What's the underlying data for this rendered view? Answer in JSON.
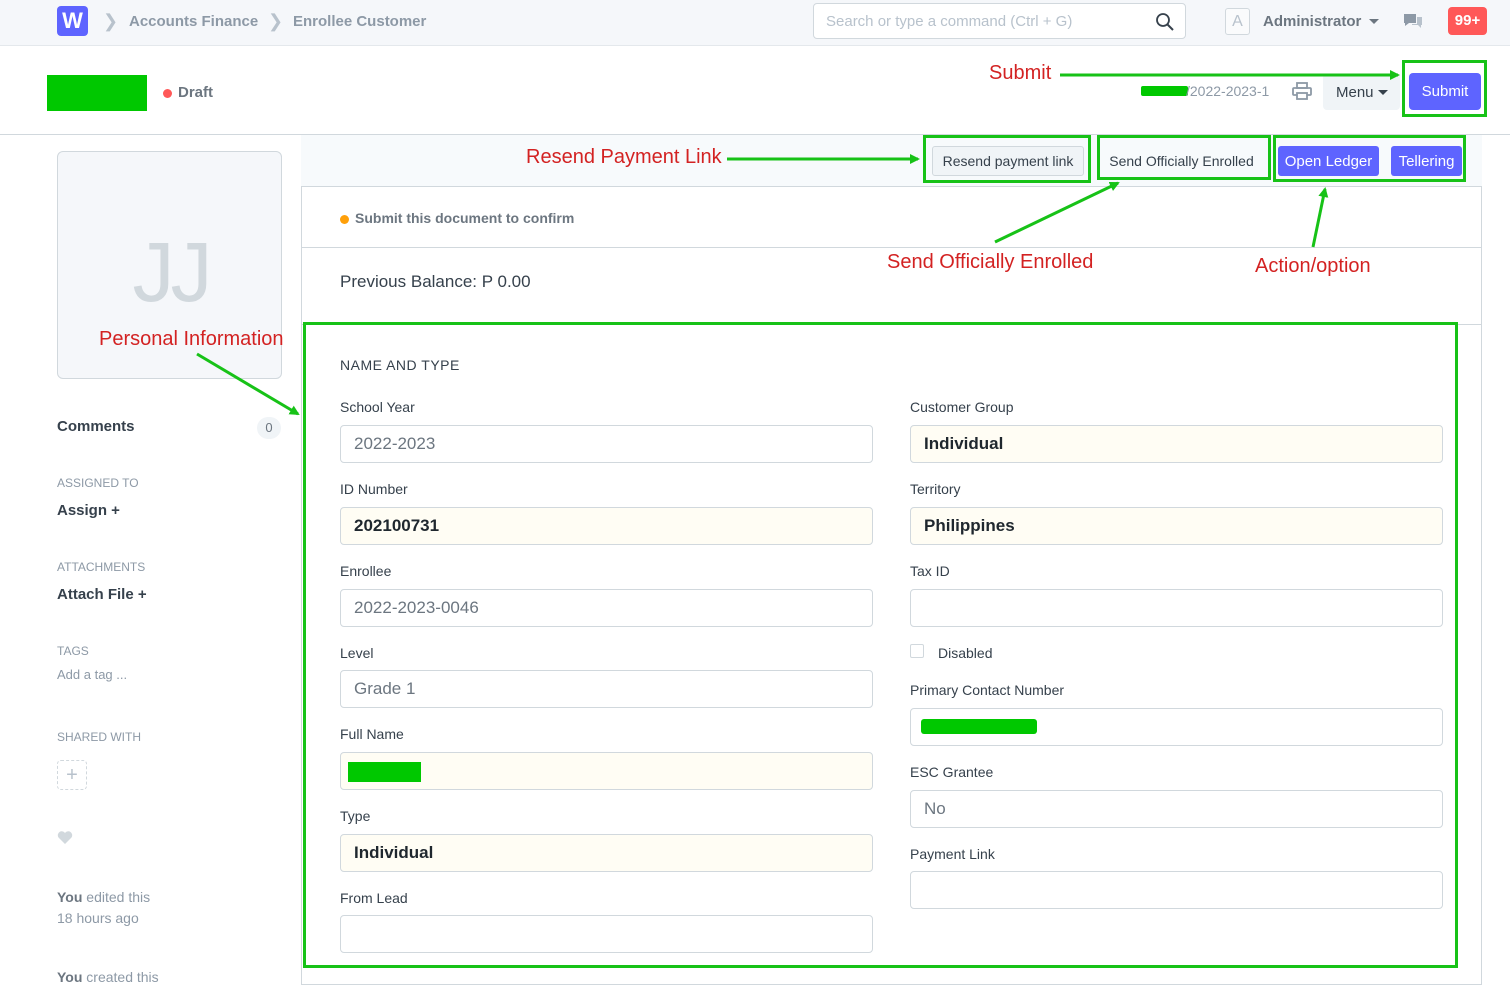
{
  "navbar": {
    "logo_letter": "W",
    "breadcrumbs": [
      "Accounts Finance",
      "Enrollee Customer"
    ],
    "search_placeholder": "Search or type a command (Ctrl + G)",
    "avatar_letter": "A",
    "user_name": "Administrator",
    "notification_count": "99+"
  },
  "page_head": {
    "status": "Draft",
    "doc_name_suffix": "/2022-2023-1",
    "menu_label": "Menu",
    "submit_label": "Submit"
  },
  "actions": {
    "resend_payment_link": "Resend payment link",
    "send_officially_enrolled": "Send Officially Enrolled",
    "open_ledger": "Open Ledger",
    "tellering": "Tellering"
  },
  "indicator": {
    "text": "Submit this document to confirm"
  },
  "balance_text": "Previous Balance: P 0.00",
  "sidebar": {
    "initials": "JJ",
    "comments_label": "Comments",
    "comments_count": "0",
    "assigned_to_label": "ASSIGNED TO",
    "assign_label": "Assign +",
    "attachments_label": "ATTACHMENTS",
    "attach_file_label": "Attach File +",
    "tags_label": "TAGS",
    "add_tag_label": "Add a tag ...",
    "shared_with_label": "SHARED WITH",
    "share_plus": "+",
    "activity": [
      {
        "who": "You",
        "action": " edited this",
        "when": "18 hours ago"
      },
      {
        "who": "You",
        "action": " created this",
        "when": ""
      }
    ]
  },
  "form": {
    "section_title": "NAME AND TYPE",
    "left": {
      "school_year": {
        "label": "School Year",
        "value": "2022-2023"
      },
      "id_number": {
        "label": "ID Number",
        "value": "202100731"
      },
      "enrollee": {
        "label": "Enrollee",
        "value": "2022-2023-0046"
      },
      "level": {
        "label": "Level",
        "value": "Grade 1"
      },
      "full_name": {
        "label": "Full Name",
        "value": ""
      },
      "type": {
        "label": "Type",
        "value": "Individual"
      },
      "from_lead": {
        "label": "From Lead",
        "value": ""
      }
    },
    "right": {
      "customer_group": {
        "label": "Customer Group",
        "value": "Individual"
      },
      "territory": {
        "label": "Territory",
        "value": "Philippines"
      },
      "tax_id": {
        "label": "Tax ID",
        "value": ""
      },
      "disabled": {
        "label": "Disabled",
        "checked": false
      },
      "primary_contact": {
        "label": "Primary Contact Number",
        "value": ""
      },
      "esc_grantee": {
        "label": "ESC Grantee",
        "value": "No"
      },
      "payment_link": {
        "label": "Payment Link",
        "value": ""
      }
    }
  },
  "annotations": {
    "submit": "Submit",
    "resend_payment_link": "Resend Payment Link",
    "send_officially_enrolled": "Send Officially Enrolled",
    "action_option": "Action/option",
    "personal_information": "Personal Information"
  },
  "colors": {
    "primary": "#5e64ff",
    "annotation_box": "#17c217",
    "annotation_text": "#d32222",
    "redaction": "#00c800",
    "draft_indicator": "#ff5858",
    "confirm_indicator": "#ffa00a"
  }
}
